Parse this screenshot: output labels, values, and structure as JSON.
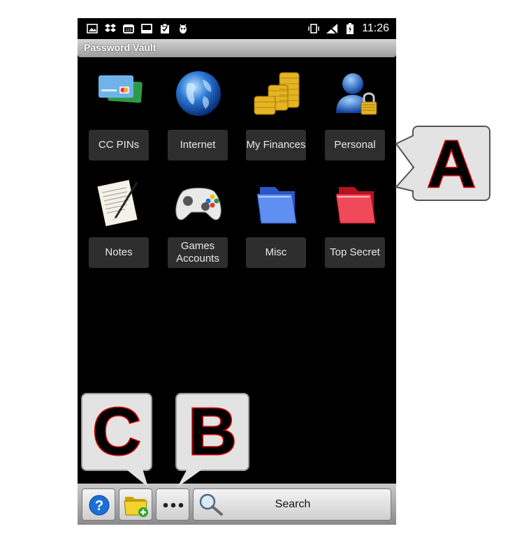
{
  "status_bar": {
    "time": "11:26",
    "left_icons": [
      "image-icon",
      "dropbox-icon",
      "calendar-icon",
      "screen-icon",
      "clipboard-icon",
      "bug-icon"
    ],
    "right_icons": [
      "vibrate-icon",
      "no-signal-icon",
      "battery-icon"
    ]
  },
  "app": {
    "title": "Password Vault"
  },
  "categories": [
    {
      "label": "CC PINs",
      "icon": "credit-cards-icon"
    },
    {
      "label": "Internet",
      "icon": "globe-icon"
    },
    {
      "label": "My Finances",
      "icon": "coins-icon"
    },
    {
      "label": "Personal",
      "icon": "user-lock-icon"
    },
    {
      "label": "Notes",
      "icon": "notepad-pen-icon"
    },
    {
      "label": "Games Accounts",
      "icon": "gamepad-icon"
    },
    {
      "label": "Misc",
      "icon": "blue-folder-icon"
    },
    {
      "label": "Top Secret",
      "icon": "red-folder-icon"
    }
  ],
  "toolbar": {
    "help_icon": "help-icon",
    "add_folder_icon": "add-folder-icon",
    "more_icon": "more-icon",
    "search_label": "Search"
  },
  "annotations": {
    "a": "A",
    "b": "B",
    "c": "C"
  },
  "colors": {
    "callout_fill": "#e3e3e3",
    "letter_outline": "#e00000",
    "tile_bg": "#2e2e2e"
  }
}
